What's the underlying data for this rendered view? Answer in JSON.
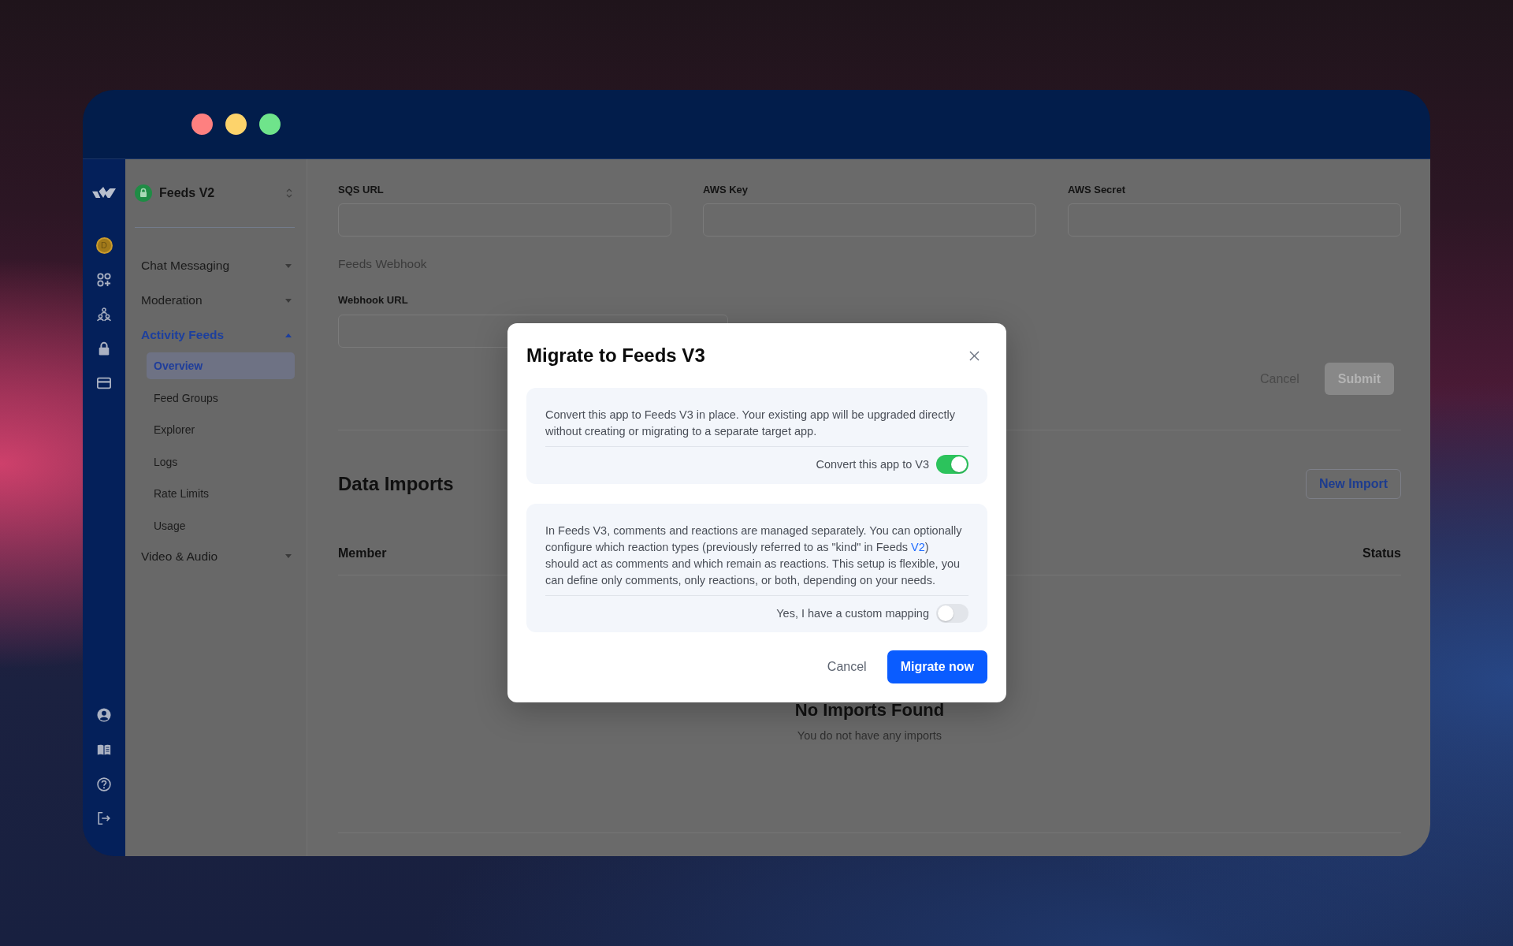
{
  "window": {
    "controls": [
      {
        "color": "#fe8080"
      },
      {
        "color": "#fdd36b"
      },
      {
        "color": "#6fe48b"
      }
    ]
  },
  "rail": {
    "top": [
      {
        "kind": "logo"
      },
      {
        "kind": "avatar",
        "label": "D"
      },
      {
        "kind": "apps"
      },
      {
        "kind": "team"
      },
      {
        "kind": "security"
      },
      {
        "kind": "billing"
      }
    ],
    "bottom": [
      {
        "kind": "profile"
      },
      {
        "kind": "docs"
      },
      {
        "kind": "help"
      },
      {
        "kind": "logout"
      }
    ]
  },
  "sidebar": {
    "app_name": "Feeds V2",
    "items": [
      {
        "label": "Chat Messaging",
        "expanded": false,
        "selected": false
      },
      {
        "label": "Moderation",
        "expanded": false,
        "selected": false
      },
      {
        "label": "Activity Feeds",
        "expanded": true,
        "selected": true,
        "children": [
          {
            "label": "Overview",
            "selected": true
          },
          {
            "label": "Feed Groups",
            "selected": false
          },
          {
            "label": "Explorer",
            "selected": false
          },
          {
            "label": "Logs",
            "selected": false
          },
          {
            "label": "Rate Limits",
            "selected": false
          },
          {
            "label": "Usage",
            "selected": false
          }
        ]
      },
      {
        "label": "Video & Audio",
        "expanded": false,
        "selected": false
      }
    ]
  },
  "sqs_form": {
    "fields": [
      {
        "label": "SQS URL"
      },
      {
        "label": "AWS Key"
      },
      {
        "label": "AWS Secret"
      }
    ]
  },
  "webhook": {
    "heading": "Feeds Webhook",
    "fields": [
      {
        "label": "Webhook URL"
      }
    ]
  },
  "form_buttons": [
    {
      "label": "Cancel",
      "kind": "secondary",
      "disabled": false
    },
    {
      "label": "Submit",
      "kind": "primary",
      "disabled": true
    }
  ],
  "data_imports": {
    "title": "Data Imports",
    "new_button": "New Import",
    "columns": [
      "Member",
      "Status"
    ],
    "empty_title": "No Imports Found",
    "empty_text": "You do not have any imports"
  },
  "modal": {
    "title": "Migrate to Feeds V3",
    "sections": [
      {
        "text": "Convert this app to Feeds V3 in place. Your existing app will be upgraded directly without creating or migrating to a separate target app.",
        "toggle_label": "Convert this app to V3",
        "on": true
      },
      {
        "text": "In Feeds V3, comments and reactions are managed separately. You can optionally configure which reaction types (previously referred to as \"kind\" in Feeds ",
        "link": "V2",
        "text_after": ") should act as comments and which remain as reactions. This setup is flexible, you can define only comments, only reactions, or both, depending on your needs.",
        "toggle_label": "Yes, I have a custom mapping",
        "on": false
      }
    ],
    "buttons": [
      {
        "label": "Cancel",
        "kind": "secondary"
      },
      {
        "label": "Migrate now",
        "kind": "primary"
      }
    ]
  }
}
